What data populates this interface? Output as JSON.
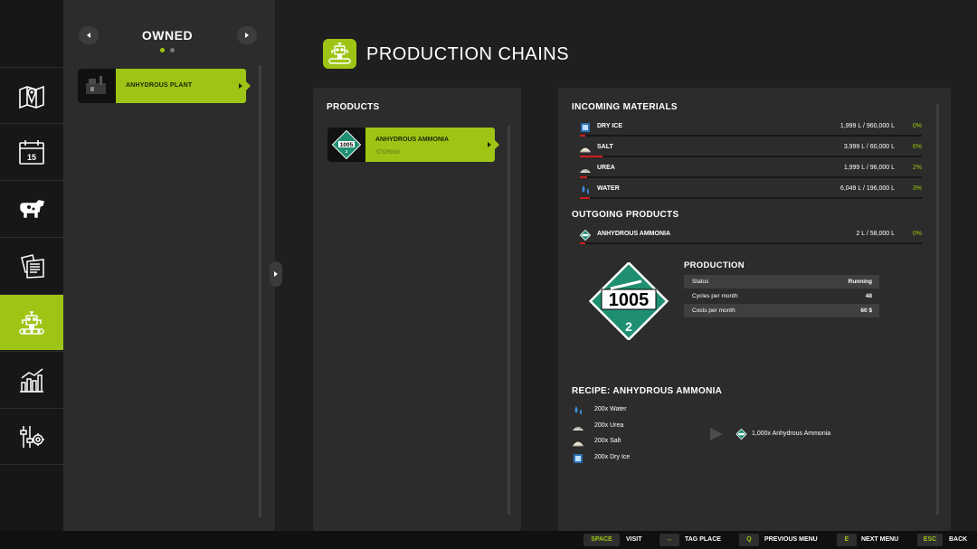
{
  "owned_panel": {
    "title": "OWNED",
    "prev_label": "◂",
    "next_label": "▸",
    "pages": 2,
    "current_page": 1,
    "items": [
      {
        "label": "ANHYDROUS PLANT",
        "selected": true
      }
    ]
  },
  "sidebar": {
    "items": [
      {
        "icon": "map-pin-icon",
        "active": false
      },
      {
        "icon": "calendar-icon",
        "active": false,
        "text": "15"
      },
      {
        "icon": "cow-icon",
        "active": false
      },
      {
        "icon": "contracts-icon",
        "active": false
      },
      {
        "icon": "production-icon",
        "active": true
      },
      {
        "icon": "statistics-icon",
        "active": false
      },
      {
        "icon": "settings-icon",
        "active": false
      }
    ]
  },
  "header": {
    "title": "PRODUCTION CHAINS",
    "icon": "production-icon"
  },
  "products_panel": {
    "heading": "PRODUCTS",
    "items": [
      {
        "name": "ANHYDROUS AMMONIA",
        "status": "STORING",
        "icon_code": "1005",
        "icon_class": "2"
      }
    ]
  },
  "incoming": {
    "heading": "INCOMING MATERIALS",
    "rows": [
      {
        "name": "DRY ICE",
        "amount": "1,999 L / 960,000 L",
        "pct": "0%",
        "fill": 0.002,
        "icon": "dry-ice-icon"
      },
      {
        "name": "SALT",
        "amount": "3,999 L / 60,000 L",
        "pct": "6%",
        "fill": 0.066,
        "icon": "salt-icon"
      },
      {
        "name": "UREA",
        "amount": "1,999 L / 96,000 L",
        "pct": "2%",
        "fill": 0.02,
        "icon": "urea-icon"
      },
      {
        "name": "WATER",
        "amount": "6,049 L / 196,000 L",
        "pct": "3%",
        "fill": 0.03,
        "icon": "water-icon"
      }
    ]
  },
  "outgoing": {
    "heading": "OUTGOING PRODUCTS",
    "rows": [
      {
        "name": "ANHYDROUS AMMONIA",
        "amount": "2 L / 58,000 L",
        "pct": "0%",
        "fill": 0.0,
        "icon": "anhydrous-ammonia-icon"
      }
    ]
  },
  "production": {
    "heading": "PRODUCTION",
    "placard_code": "1005",
    "placard_class": "2",
    "rows": [
      {
        "key": "Status",
        "value": "Running"
      },
      {
        "key": "Cycles per month",
        "value": "48"
      },
      {
        "key": "Costs per month",
        "value": "60 $"
      }
    ]
  },
  "recipe": {
    "heading": "RECIPE: ANHYDROUS AMMONIA",
    "inputs": [
      {
        "text": "200x Water",
        "icon": "water-icon"
      },
      {
        "text": "200x Urea",
        "icon": "urea-icon"
      },
      {
        "text": "200x Salt",
        "icon": "salt-icon"
      },
      {
        "text": "200x Dry Ice",
        "icon": "dry-ice-icon"
      }
    ],
    "output": {
      "text": "1,000x Anhydrous Ammonia",
      "icon": "anhydrous-ammonia-icon"
    }
  },
  "bottom_bar": {
    "actions": [
      {
        "key": "SPACE",
        "label": "VISIT"
      },
      {
        "key": "↔",
        "label": "TAG PLACE"
      },
      {
        "key": "Q",
        "label": "PREVIOUS MENU"
      },
      {
        "key": "E",
        "label": "NEXT MENU"
      },
      {
        "key": "ESC",
        "label": "BACK"
      }
    ]
  },
  "colors": {
    "accent": "#9ec515",
    "background": "#1e1f1e",
    "panel": "#2b2c2b",
    "bar_fill": "#d11c1c",
    "placard": "#1f8f72"
  }
}
